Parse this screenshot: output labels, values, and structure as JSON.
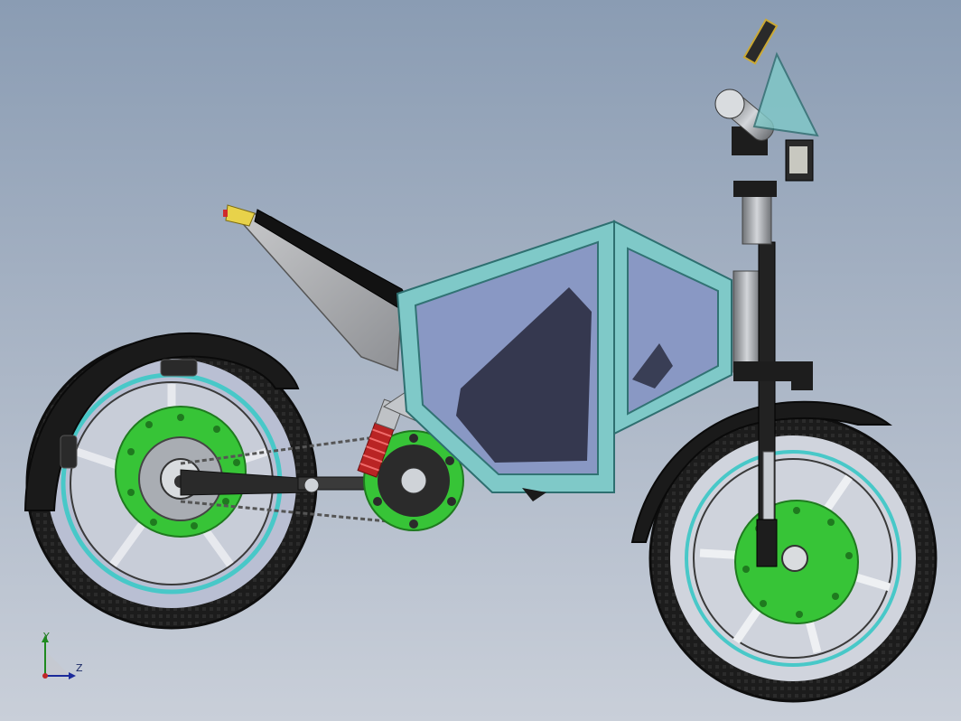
{
  "viewport": {
    "background_top": "#8a9cb3",
    "background_bottom": "#c9cfd9"
  },
  "model": {
    "frame_color": "#7fc9c8",
    "glass_color": "#8a96c4",
    "disc_color": "#37c437",
    "tire_color": "#1a1a1a",
    "rim_accent_color": "#48c8c8",
    "spring_color": "#c02626"
  },
  "triad": {
    "y_label": "Y",
    "z_label": "Z"
  }
}
